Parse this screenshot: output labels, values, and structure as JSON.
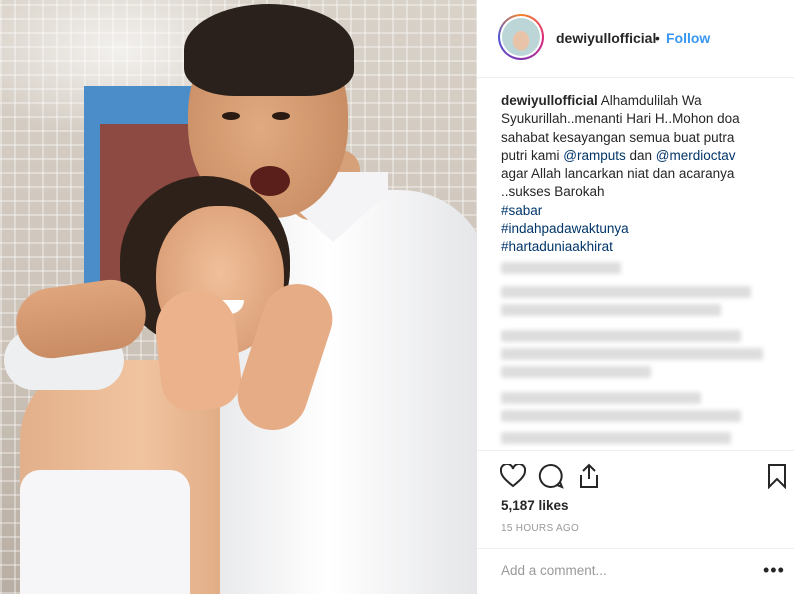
{
  "header": {
    "username": "dewiyullofficial",
    "separator": "•",
    "follow_label": "Follow"
  },
  "caption": {
    "username": "dewiyullofficial",
    "text_part1": " Alhamdulilah Wa Syukurillah..menanti Hari H..Mohon doa sahabat kesayangan semua buat putra putri kami ",
    "mention1": "@ramputs",
    "text_part2": " dan ",
    "mention2": "@merdioctav",
    "text_part3": " agar Allah lancarkan niat dan acaranya ..sukses Barokah",
    "hashtags": [
      "#sabar",
      "#indahpadawaktunya",
      "#hartaduniaakhirat"
    ]
  },
  "actions": {
    "like_icon": "heart-icon",
    "comment_icon": "comment-icon",
    "share_icon": "share-icon",
    "save_icon": "bookmark-icon"
  },
  "likes": "5,187 likes",
  "timestamp": "15 HOURS AGO",
  "comment": {
    "placeholder": "Add a comment...",
    "more_label": "•••"
  },
  "colors": {
    "accent": "#3897f0",
    "link": "#003569",
    "muted": "#999999"
  }
}
